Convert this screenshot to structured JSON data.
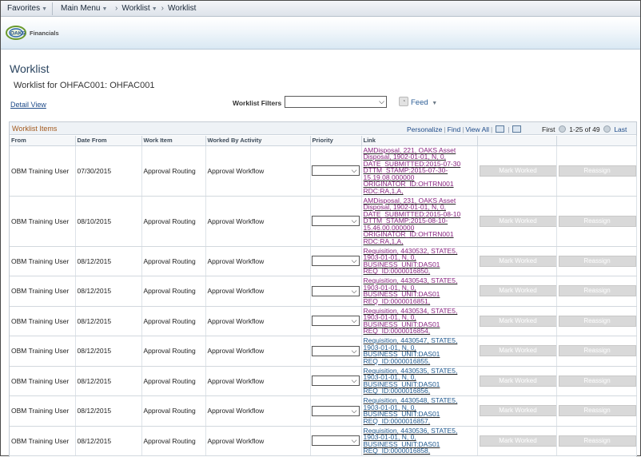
{
  "nav": {
    "favorites": "Favorites",
    "main_menu": "Main Menu",
    "worklist_menu": "Worklist",
    "worklist_crumb": "Worklist"
  },
  "logo": {
    "text": "OAKS",
    "subtext": "Financials"
  },
  "page": {
    "title": "Worklist",
    "subtitle": "Worklist for OHFAC001: OHFAC001",
    "detail_view": "Detail View",
    "filters_label": "Worklist Filters",
    "filters_value": "",
    "feed_label": "Feed"
  },
  "grid": {
    "title": "Worklist Items",
    "tools": {
      "personalize": "Personalize",
      "find": "Find",
      "view_all": "View All"
    },
    "pager": {
      "first": "First",
      "range": "1-25 of 49",
      "last": "Last"
    },
    "columns": [
      "From",
      "Date From",
      "Work Item",
      "Worked By Activity",
      "Priority",
      "Link",
      "",
      ""
    ],
    "mark_worked_label": "Mark Worked",
    "reassign_label": "Reassign",
    "rows": [
      {
        "from": "OBM Training User",
        "date": "07/30/2015",
        "work_item": "Approval Routing",
        "activity": "Approval Workflow",
        "priority": "",
        "link": "AMDisposal, 221, OAKS Asset Disposal, 1902-01-01, N, 0, DATE_SUBMITTED:2015-07-30 DTTM_STAMP:2015-07-30-15.19.08.000000 ORIGINATOR_ID:OHTRN001 RDC:RA,1,A,",
        "link_color": "#8a2582"
      },
      {
        "from": "OBM Training User",
        "date": "08/10/2015",
        "work_item": "Approval Routing",
        "activity": "Approval Workflow",
        "priority": "",
        "link": "AMDisposal, 231, OAKS Asset Disposal, 1902-01-01, N, 0, DATE_SUBMITTED:2015-08-10 DTTM_STAMP:2015-08-10-15.46.00.000000 ORIGINATOR_ID:OHTRN001 RDC:RA,1,A,",
        "link_color": "#8a2582"
      },
      {
        "from": "OBM Training User",
        "date": "08/12/2015",
        "work_item": "Approval Routing",
        "activity": "Approval Workflow",
        "priority": "",
        "link": "Requisition, 4430532, STATE5, 1903-01-01, N, 0, BUSINESS_UNIT:DAS01 REQ_ID:0000016850,",
        "link_color": "#8a2582"
      },
      {
        "from": "OBM Training User",
        "date": "08/12/2015",
        "work_item": "Approval Routing",
        "activity": "Approval Workflow",
        "priority": "",
        "link": "Requisition, 4430543, STATE5, 1903-01-01, N, 0, BUSINESS_UNIT:DAS01 REQ_ID:0000016851,",
        "link_color": "#8a2582"
      },
      {
        "from": "OBM Training User",
        "date": "08/12/2015",
        "work_item": "Approval Routing",
        "activity": "Approval Workflow",
        "priority": "",
        "link": "Requisition, 4430534, STATE5, 1903-01-01, N, 0, BUSINESS_UNIT:DAS01 REQ_ID:0000016854,",
        "link_color": "#8a2582"
      },
      {
        "from": "OBM Training User",
        "date": "08/12/2015",
        "work_item": "Approval Routing",
        "activity": "Approval Workflow",
        "priority": "",
        "link": "Requisition, 4430547, STATE5, 1903-01-01, N, 0, BUSINESS_UNIT:DAS01 REQ_ID:0000016855,",
        "link_color": "#215a90"
      },
      {
        "from": "OBM Training User",
        "date": "08/12/2015",
        "work_item": "Approval Routing",
        "activity": "Approval Workflow",
        "priority": "",
        "link": "Requisition, 4430535, STATE5, 1903-01-01, N, 0, BUSINESS_UNIT:DAS01 REQ_ID:0000016856,",
        "link_color": "#215a90"
      },
      {
        "from": "OBM Training User",
        "date": "08/12/2015",
        "work_item": "Approval Routing",
        "activity": "Approval Workflow",
        "priority": "",
        "link": "Requisition, 4430548, STATE5, 1903-01-01, N, 0, BUSINESS_UNIT:DAS01 REQ_ID:0000016857,",
        "link_color": "#215a90"
      },
      {
        "from": "OBM Training User",
        "date": "08/12/2015",
        "work_item": "Approval Routing",
        "activity": "Approval Workflow",
        "priority": "",
        "link": "Requisition, 4430536, STATE5, 1903-01-01, N, 0, BUSINESS_UNIT:DAS01 REQ_ID:0000016858,",
        "link_color": "#215a90"
      }
    ]
  }
}
